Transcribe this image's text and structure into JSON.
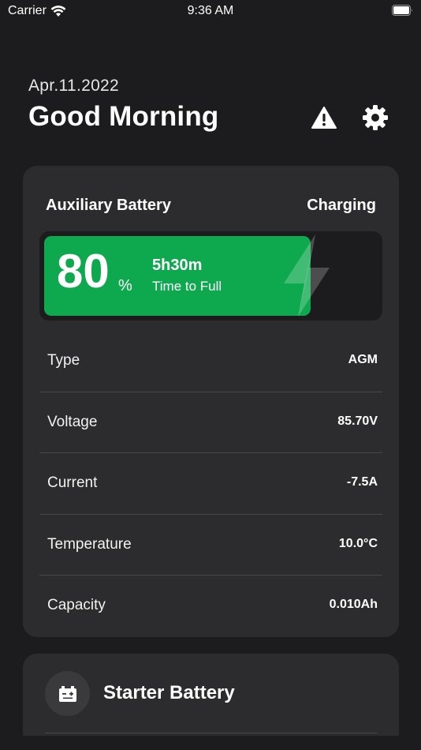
{
  "status_bar": {
    "carrier": "Carrier",
    "time": "9:36 AM",
    "icons": [
      "wifi-icon",
      "battery-icon"
    ]
  },
  "header": {
    "date": "Apr.11.2022",
    "greeting": "Good Morning",
    "icons": [
      "warning-icon",
      "gear-icon"
    ]
  },
  "auxiliary": {
    "title": "Auxiliary Battery",
    "status": "Charging",
    "percent": "80",
    "percent_unit": "%",
    "level_fraction": 0.8,
    "time_to_full": "5h30m",
    "time_to_full_label": "Time to Full",
    "fill_color": "#0ea94f",
    "rows": [
      {
        "label": "Type",
        "value": "AGM"
      },
      {
        "label": "Voltage",
        "value": "85.70V"
      },
      {
        "label": "Current",
        "value": "-7.5A"
      },
      {
        "label": "Temperature",
        "value": "10.0°C"
      },
      {
        "label": "Capacity",
        "value": "0.010Ah"
      }
    ]
  },
  "starter": {
    "title": "Starter Battery",
    "icon": "car-battery-icon"
  },
  "colors": {
    "background": "#1c1c1e",
    "card": "#2c2c2e",
    "accent_green": "#0ea94f"
  }
}
